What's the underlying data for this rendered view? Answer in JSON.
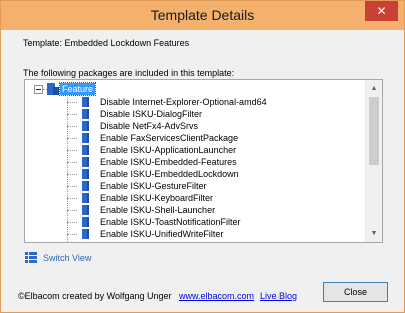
{
  "window": {
    "title": "Template Details",
    "close_glyph": "✕"
  },
  "template_label": "Template: Embedded Lockdown Features",
  "packages_label": "The following packages are included in this template:",
  "tree": {
    "root_label": "Feature",
    "items": [
      "Disable Internet-Explorer-Optional-amd64",
      "Disable ISKU-DialogFilter",
      "Disable NetFx4-AdvSrvs",
      "Enable FaxServicesClientPackage",
      "Enable ISKU-ApplicationLauncher",
      "Enable ISKU-Embedded-Features",
      "Enable ISKU-EmbeddedLockdown",
      "Enable ISKU-GestureFilter",
      "Enable ISKU-KeyboardFilter",
      "Enable ISKU-Shell-Launcher",
      "Enable ISKU-ToastNotificationFilter",
      "Enable ISKU-UnifiedWriteFilter"
    ]
  },
  "switch_view": {
    "label": "Switch View",
    "icon": "list-view-icon"
  },
  "footer": {
    "credits": "©Elbacom created by Wolfgang Unger",
    "site_link": "www.elbacom.com",
    "blog_link": "Live Blog",
    "close_button": "Close"
  },
  "colors": {
    "titlebar": "#f3b16d",
    "close_button": "#c74135",
    "selection": "#3399ff",
    "package_icon": "#2a67c9",
    "link": "#0000ee"
  }
}
